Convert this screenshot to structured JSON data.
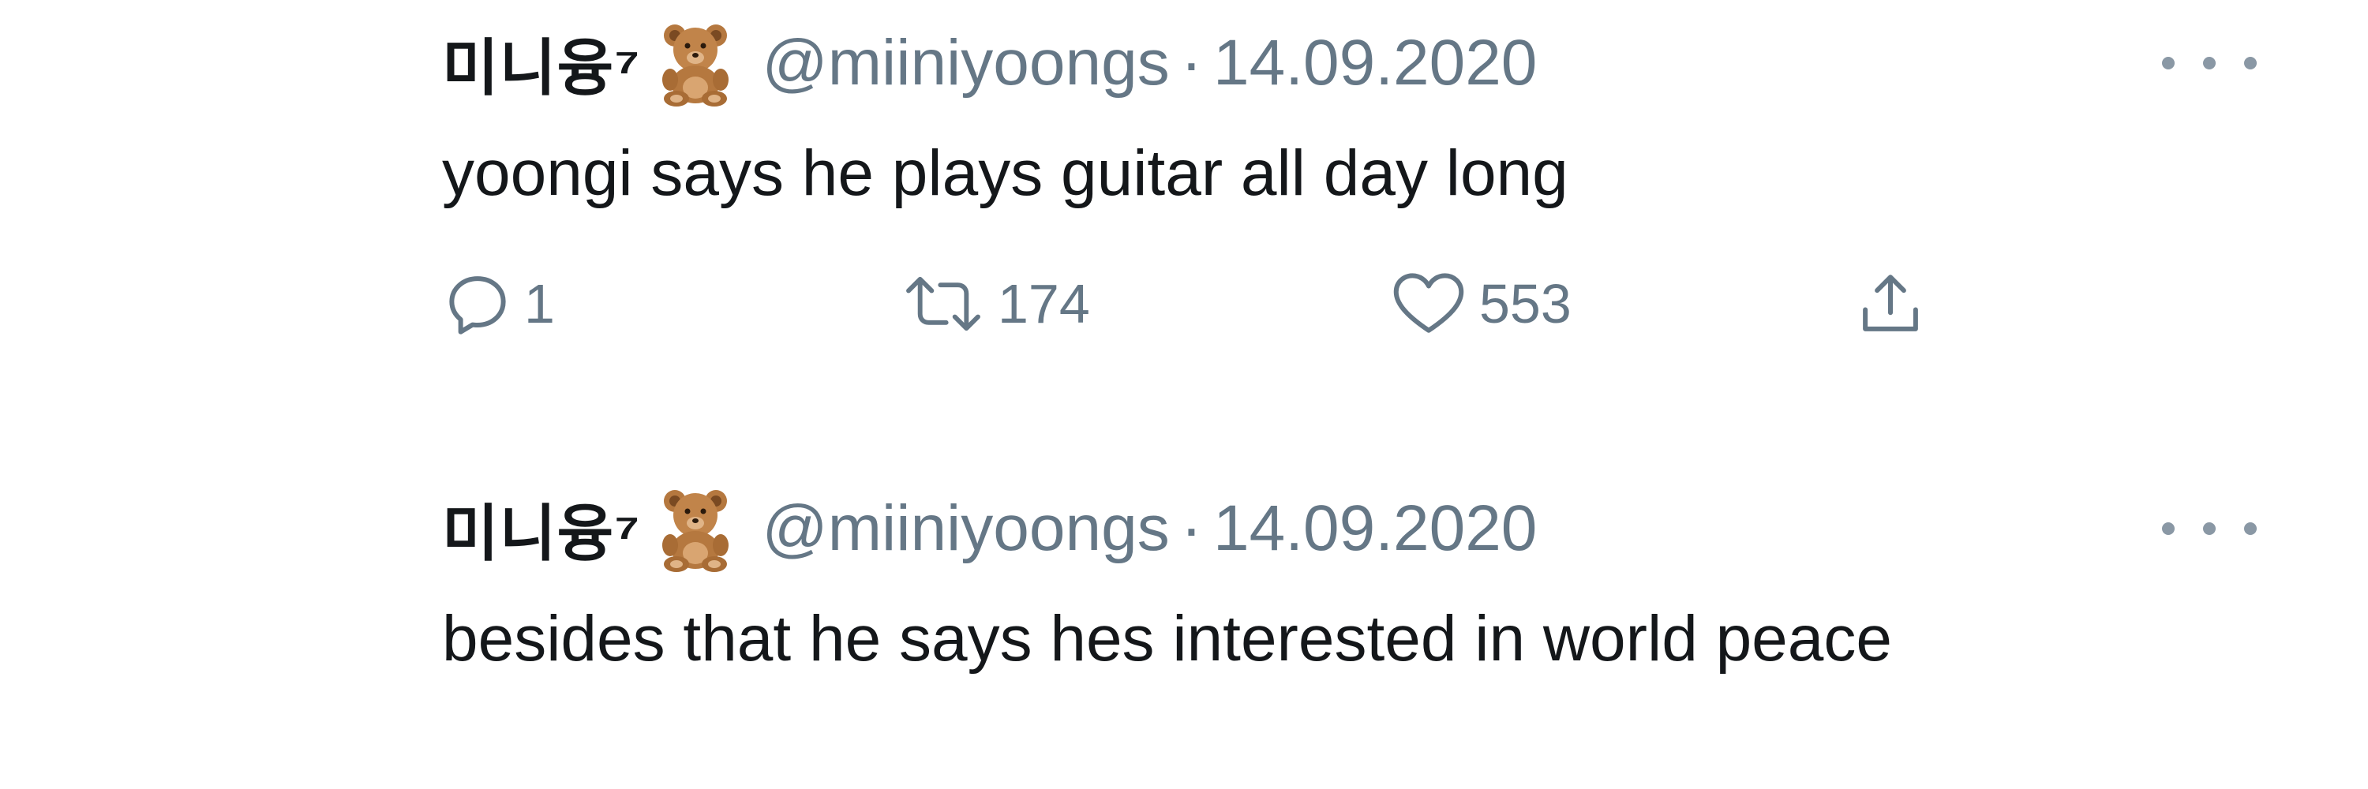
{
  "tweets": [
    {
      "display_name": "미니융⁷",
      "emoji_icon": "teddy-bear-icon",
      "handle": "@miiniyoongs",
      "separator": "·",
      "date": "14.09.2020",
      "text": "yoongi says he plays guitar all day long",
      "replies": "1",
      "retweets": "174",
      "likes": "553"
    },
    {
      "display_name": "미니융⁷",
      "emoji_icon": "teddy-bear-icon",
      "handle": "@miiniyoongs",
      "separator": "·",
      "date": "14.09.2020",
      "text": "besides that he says hes interested in world peace"
    }
  ],
  "colors": {
    "text": "#14171a",
    "secondary": "#657786",
    "bear_fur": "#b5783f",
    "bear_dark": "#7a4a22"
  }
}
